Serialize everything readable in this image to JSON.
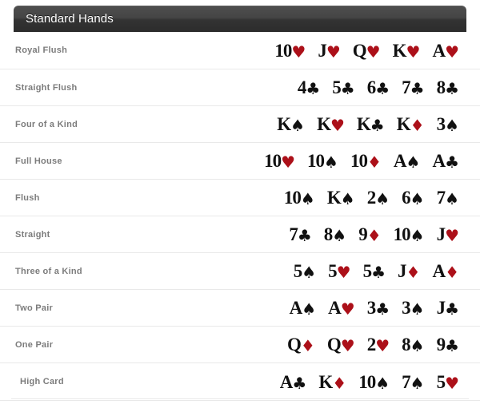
{
  "header": {
    "title": "Standard Hands"
  },
  "suit_symbols": {
    "hearts": "♥",
    "diamonds": "♦",
    "spades": "♠",
    "clubs": "♣"
  },
  "colors": {
    "red_suit": "#ac1019",
    "black_suit": "#111111",
    "header_bg_top": "#4f4f4f",
    "header_bg_bottom": "#2c2c2c",
    "header_text": "#ffffff",
    "row_label": "#7c7c7c",
    "row_divider": "#e9e9e9",
    "panel_bg": "#ffffff"
  },
  "rows": [
    {
      "name": "Royal Flush",
      "cards": [
        {
          "rank": "10",
          "suit": "♥",
          "color": "red"
        },
        {
          "rank": "J",
          "suit": "♥",
          "color": "red"
        },
        {
          "rank": "Q",
          "suit": "♥",
          "color": "red"
        },
        {
          "rank": "K",
          "suit": "♥",
          "color": "red"
        },
        {
          "rank": "A",
          "suit": "♥",
          "color": "red"
        }
      ]
    },
    {
      "name": "Straight Flush",
      "cards": [
        {
          "rank": "4",
          "suit": "♣",
          "color": "black"
        },
        {
          "rank": "5",
          "suit": "♣",
          "color": "black"
        },
        {
          "rank": "6",
          "suit": "♣",
          "color": "black"
        },
        {
          "rank": "7",
          "suit": "♣",
          "color": "black"
        },
        {
          "rank": "8",
          "suit": "♣",
          "color": "black"
        }
      ]
    },
    {
      "name": "Four of a Kind",
      "cards": [
        {
          "rank": "K",
          "suit": "♠",
          "color": "black"
        },
        {
          "rank": "K",
          "suit": "♥",
          "color": "red"
        },
        {
          "rank": "K",
          "suit": "♣",
          "color": "black"
        },
        {
          "rank": "K",
          "suit": "♦",
          "color": "red"
        },
        {
          "rank": "3",
          "suit": "♠",
          "color": "black"
        }
      ]
    },
    {
      "name": "Full House",
      "cards": [
        {
          "rank": "10",
          "suit": "♥",
          "color": "red"
        },
        {
          "rank": "10",
          "suit": "♠",
          "color": "black"
        },
        {
          "rank": "10",
          "suit": "♦",
          "color": "red"
        },
        {
          "rank": "A",
          "suit": "♠",
          "color": "black"
        },
        {
          "rank": "A",
          "suit": "♣",
          "color": "black"
        }
      ]
    },
    {
      "name": "Flush",
      "cards": [
        {
          "rank": "10",
          "suit": "♠",
          "color": "black"
        },
        {
          "rank": "K",
          "suit": "♠",
          "color": "black"
        },
        {
          "rank": "2",
          "suit": "♠",
          "color": "black"
        },
        {
          "rank": "6",
          "suit": "♠",
          "color": "black"
        },
        {
          "rank": "7",
          "suit": "♠",
          "color": "black"
        }
      ]
    },
    {
      "name": "Straight",
      "cards": [
        {
          "rank": "7",
          "suit": "♣",
          "color": "black"
        },
        {
          "rank": "8",
          "suit": "♠",
          "color": "black"
        },
        {
          "rank": "9",
          "suit": "♦",
          "color": "red"
        },
        {
          "rank": "10",
          "suit": "♠",
          "color": "black"
        },
        {
          "rank": "J",
          "suit": "♥",
          "color": "red"
        }
      ]
    },
    {
      "name": "Three of a Kind",
      "cards": [
        {
          "rank": "5",
          "suit": "♠",
          "color": "black"
        },
        {
          "rank": "5",
          "suit": "♥",
          "color": "red"
        },
        {
          "rank": "5",
          "suit": "♣",
          "color": "black"
        },
        {
          "rank": "J",
          "suit": "♦",
          "color": "red"
        },
        {
          "rank": "A",
          "suit": "♦",
          "color": "red"
        }
      ]
    },
    {
      "name": "Two Pair",
      "cards": [
        {
          "rank": "A",
          "suit": "♠",
          "color": "black"
        },
        {
          "rank": "A",
          "suit": "♥",
          "color": "red"
        },
        {
          "rank": "3",
          "suit": "♣",
          "color": "black"
        },
        {
          "rank": "3",
          "suit": "♠",
          "color": "black"
        },
        {
          "rank": "J",
          "suit": "♣",
          "color": "black"
        }
      ]
    },
    {
      "name": "One Pair",
      "cards": [
        {
          "rank": "Q",
          "suit": "♦",
          "color": "red"
        },
        {
          "rank": "Q",
          "suit": "♥",
          "color": "red"
        },
        {
          "rank": "2",
          "suit": "♥",
          "color": "red"
        },
        {
          "rank": "8",
          "suit": "♠",
          "color": "black"
        },
        {
          "rank": "9",
          "suit": "♣",
          "color": "black"
        }
      ]
    },
    {
      "name": "High Card",
      "indented": true,
      "cards": [
        {
          "rank": "A",
          "suit": "♣",
          "color": "black"
        },
        {
          "rank": "K",
          "suit": "♦",
          "color": "red"
        },
        {
          "rank": "10",
          "suit": "♠",
          "color": "black"
        },
        {
          "rank": "7",
          "suit": "♠",
          "color": "black"
        },
        {
          "rank": "5",
          "suit": "♥",
          "color": "red"
        }
      ]
    }
  ]
}
